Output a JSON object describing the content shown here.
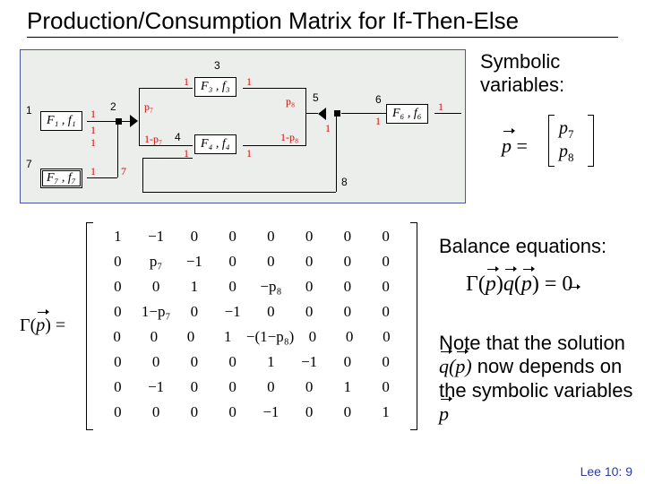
{
  "title": "Production/Consumption Matrix for If-Then-Else",
  "sidebar": {
    "symbolic_label": "Symbolic\nvariables:",
    "p_eq": "p",
    "p7": "p",
    "p7sub": "7",
    "p8": "p",
    "p8sub": "8",
    "balance_label": "Balance equations:",
    "bal_gamma": "Γ(",
    "bal_p": "p",
    "bal_mid": ")",
    "bal_q": "q",
    "bal_open2": "(",
    "bal_close2": ") = 0",
    "note_prefix": "Note that the solution ",
    "note_q": "q",
    "note_open": "(",
    "note_p": "p",
    "note_close": ")",
    "note_mid": " now depends on the symbolic variables ",
    "note_p2": "p"
  },
  "matrix_prefix": {
    "gamma": "Γ(",
    "p": "p",
    "eq": ") ="
  },
  "matrix_rows": [
    [
      "1",
      "−1",
      "0",
      "0",
      "0",
      "0",
      "0",
      "0"
    ],
    [
      "0",
      "p₇",
      "−1",
      "0",
      "0",
      "0",
      "0",
      "0"
    ],
    [
      "0",
      "0",
      "1",
      "0",
      "−p₈",
      "0",
      "0",
      "0"
    ],
    [
      "0",
      "1−p₇",
      "0",
      "−1",
      "0",
      "0",
      "0",
      "0"
    ],
    [
      "0",
      "0",
      "0",
      "1",
      "−(1−p₈)",
      "0",
      "0",
      "0"
    ],
    [
      "0",
      "0",
      "0",
      "0",
      "1",
      "−1",
      "0",
      "0"
    ],
    [
      "0",
      "−1",
      "0",
      "0",
      "0",
      "0",
      "1",
      "0"
    ],
    [
      "0",
      "0",
      "0",
      "0",
      "−1",
      "0",
      "0",
      "1"
    ]
  ],
  "diagram": {
    "actors": {
      "f1": "F₁ , f₁",
      "f3": "F₃ , f₃",
      "f4": "F₄ , f₄",
      "f6": "F₆ , f₆",
      "f7": "F₇ , f₇"
    },
    "edge_red": [
      "1",
      "1",
      "1",
      "1",
      "1",
      "1",
      "1",
      "1",
      "1",
      "1",
      "1",
      "7"
    ],
    "edge_black": {
      "n1": "1",
      "n2": "2",
      "n3": "3",
      "n4": "4",
      "n5": "5",
      "n6": "6",
      "n7": "7",
      "n8": "8"
    },
    "probs": {
      "p7": "p₇",
      "np7": "1-p₇",
      "p8": "p₈",
      "np8": "1-p₈"
    }
  },
  "footer": "Lee 10: 9"
}
